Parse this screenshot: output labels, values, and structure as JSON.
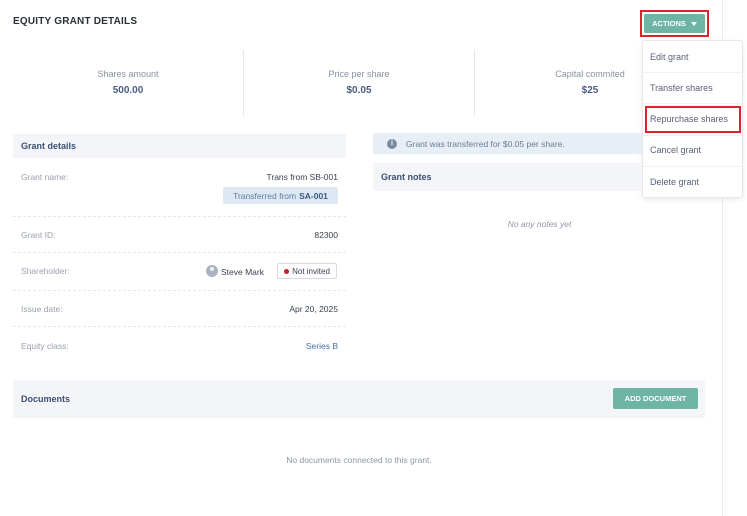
{
  "header": {
    "title": "EQUITY GRANT DETAILS",
    "actions_label": "ACTIONS"
  },
  "actions_menu": {
    "items": [
      {
        "label": "Edit grant"
      },
      {
        "label": "Transfer shares"
      },
      {
        "label": "Repurchase shares",
        "highlighted": true
      },
      {
        "label": "Cancel grant"
      },
      {
        "label": "Delete grant"
      }
    ]
  },
  "stats": [
    {
      "label": "Shares amount",
      "value": "500.00"
    },
    {
      "label": "Price per share",
      "value": "$0.05"
    },
    {
      "label": "Capital commited",
      "value": "$25"
    }
  ],
  "grant_details": {
    "title": "Grant details",
    "grant_name_label": "Grant name:",
    "grant_name_value": "Trans from SB-001",
    "transferred_prefix": "Transferred from",
    "transferred_code": "SA-001",
    "grant_id_label": "Grant ID:",
    "grant_id_value": "82300",
    "shareholder_label": "Shareholder:",
    "shareholder_name": "Steve Mark",
    "shareholder_status": "Not invited",
    "issue_date_label": "Issue date:",
    "issue_date_value": "Apr 20, 2025",
    "equity_class_label": "Equity class:",
    "equity_class_value": "Series B"
  },
  "info_banner": {
    "text": "Grant was transferred for $0.05 per share."
  },
  "notes": {
    "title": "Grant notes",
    "empty_text": "No any notes yet"
  },
  "documents": {
    "title": "Documents",
    "add_label": "ADD DOCUMENT",
    "empty_text": "No documents connected to this grant."
  },
  "colors": {
    "accent": "#6fb5a6",
    "highlight_border": "#d9262c",
    "status_dot": "#c21f27"
  }
}
